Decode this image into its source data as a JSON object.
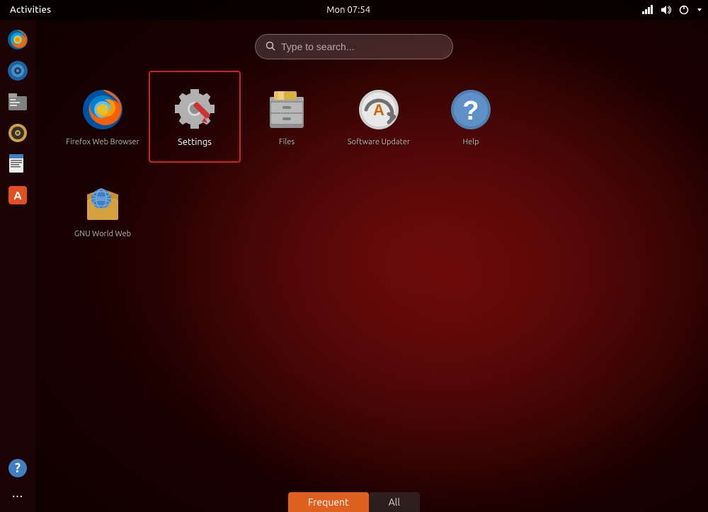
{
  "topbar": {
    "activities_label": "Activities",
    "clock": "Mon 07:54"
  },
  "search": {
    "placeholder": "Type to search..."
  },
  "sidebar": {
    "items": [
      {
        "id": "firefox",
        "label": "Firefox"
      },
      {
        "id": "rhythmbox",
        "label": "Rhythmbox"
      },
      {
        "id": "files",
        "label": "Files"
      },
      {
        "id": "disks",
        "label": "Disks"
      },
      {
        "id": "writer",
        "label": "Writer"
      },
      {
        "id": "software",
        "label": "Software"
      }
    ],
    "bottom": [
      {
        "id": "help",
        "label": "Help"
      }
    ],
    "dots_label": "···"
  },
  "apps": {
    "row1": [
      {
        "id": "firefox",
        "label": "Firefox Web Browser",
        "selected": false
      },
      {
        "id": "settings",
        "label": "Settings",
        "selected": true
      },
      {
        "id": "files",
        "label": "Files",
        "selected": false
      },
      {
        "id": "updater",
        "label": "Software Updater",
        "selected": false
      },
      {
        "id": "help",
        "label": "Help",
        "selected": false
      }
    ],
    "row2": [
      {
        "id": "gnuworld",
        "label": "GNU World Web",
        "selected": false
      }
    ]
  },
  "tabs": {
    "frequent": "Frequent",
    "all": "All"
  },
  "colors": {
    "active_tab": "#e06020",
    "selected_border": "#cc2222"
  }
}
